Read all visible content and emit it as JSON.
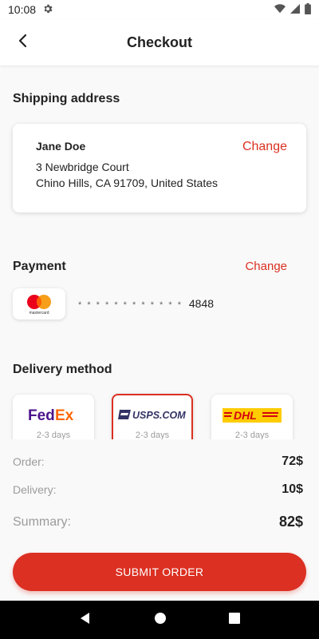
{
  "status_bar": {
    "time": "10:08",
    "icons": [
      "gear-icon",
      "wifi-icon",
      "signal-icon",
      "battery-icon"
    ]
  },
  "header": {
    "title": "Checkout",
    "back_icon": "arrow-left-icon"
  },
  "shipping": {
    "section_title": "Shipping address",
    "name": "Jane Doe",
    "address_line1": "3 Newbridge Court",
    "address_line2": "Chino Hills, CA 91709, United States",
    "change_label": "Change"
  },
  "payment": {
    "section_title": "Payment",
    "change_label": "Change",
    "card_brand": "mastercard",
    "masked": "* * * *   * * * *   * * * *",
    "last4": "4848"
  },
  "delivery": {
    "section_title": "Delivery method",
    "options": [
      {
        "name": "FedEx",
        "days": "2-3 days",
        "selected": false
      },
      {
        "name": "USPS.COM",
        "days": "2-3 days",
        "selected": true
      },
      {
        "name": "DHL",
        "days": "2-3 days",
        "selected": false
      }
    ]
  },
  "summary": {
    "order_label": "Order:",
    "order_value": "72$",
    "delivery_label": "Delivery:",
    "delivery_value": "10$",
    "summary_label": "Summary:",
    "summary_value": "82$"
  },
  "submit_label": "SUBMIT ORDER",
  "colors": {
    "accent": "#db3022",
    "background": "#f9f9f9",
    "muted": "#9b9b9b"
  },
  "nav_bar": {
    "icons": [
      "back-triangle-icon",
      "home-circle-icon",
      "recents-square-icon"
    ]
  }
}
